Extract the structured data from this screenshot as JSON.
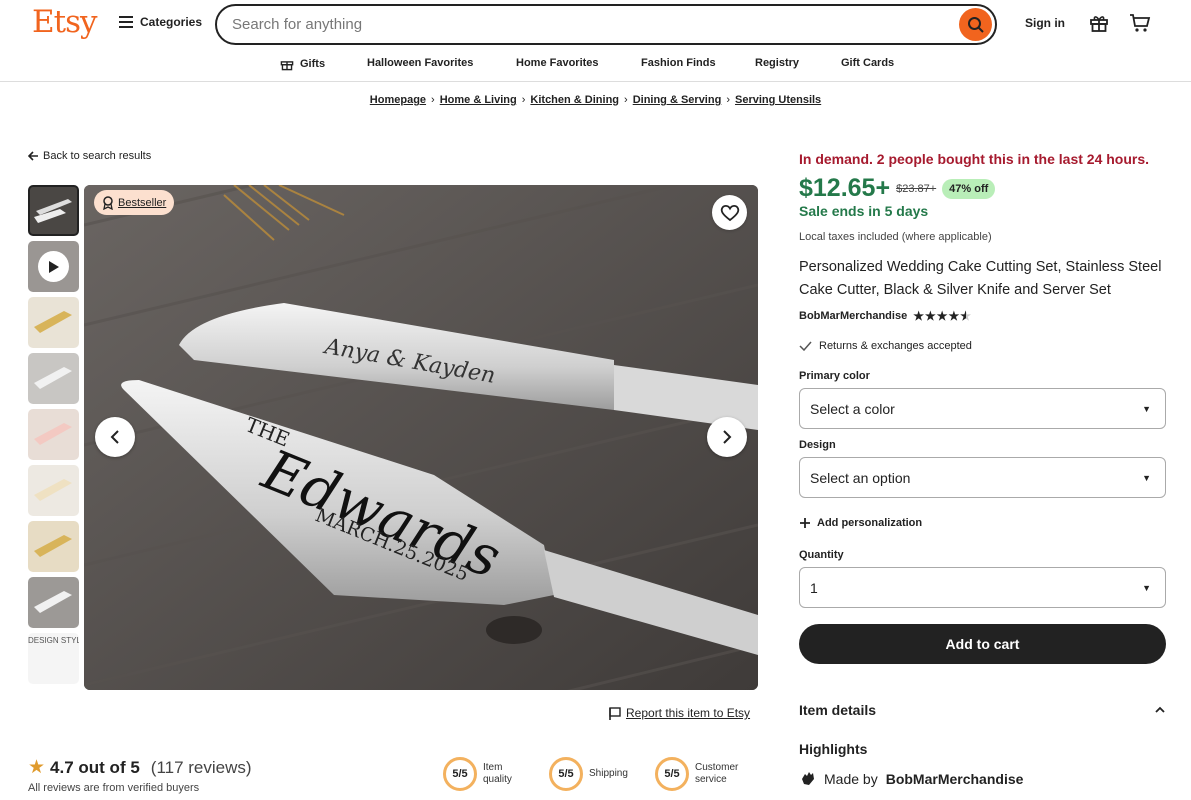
{
  "header": {
    "logo": "Etsy",
    "categories_label": "Categories",
    "search_placeholder": "Search for anything",
    "signin_label": "Sign in"
  },
  "nav": {
    "items": [
      "Gifts",
      "Halloween Favorites",
      "Home Favorites",
      "Fashion Finds",
      "Registry",
      "Gift Cards"
    ]
  },
  "breadcrumb": [
    "Homepage",
    "Home & Living",
    "Kitchen & Dining",
    "Dining & Serving",
    "Serving Utensils"
  ],
  "gallery": {
    "back_label": "Back to search results",
    "badge_label": "Bestseller",
    "report_label": "Report this item to Etsy",
    "engraving": {
      "knife_text": "Anya & Kayden",
      "server_the": "THE",
      "server_name": "Edwards",
      "server_date": "MARCH.25.2025"
    },
    "thumb_text": "DESIGN STYLE"
  },
  "reviews": {
    "rating": "4.7 out of 5",
    "count": "(117 reviews)",
    "verified": "All reviews are from verified buyers",
    "scores": [
      {
        "value": "5/5",
        "label_1": "Item",
        "label_2": "quality"
      },
      {
        "value": "5/5",
        "label_1": "Shipping",
        "label_2": ""
      },
      {
        "value": "5/5",
        "label_1": "Customer",
        "label_2": "service"
      }
    ]
  },
  "product": {
    "demand": "In demand. 2 people bought this in the last 24 hours.",
    "price": "$12.65+",
    "original_price": "$23.87+",
    "discount": "47% off",
    "sale_ends": "Sale ends in 5 days",
    "tax_note": "Local taxes included (where applicable)",
    "title": "Personalized Wedding Cake Cutting Set, Stainless Steel Cake Cutter, Black & Silver Knife and Server Set",
    "shop": "BobMarMerchandise",
    "stars": 4.5,
    "returns": "Returns & exchanges accepted",
    "primary_color_label": "Primary color",
    "primary_color_value": "Select a color",
    "design_label": "Design",
    "design_value": "Select an option",
    "personalization_label": "Add personalization",
    "quantity_label": "Quantity",
    "quantity_value": "1",
    "add_to_cart": "Add to cart",
    "item_details": "Item details",
    "highlights": "Highlights",
    "made_by_prefix": "Made by",
    "made_by_shop": "BobMarMerchandise"
  },
  "colors": {
    "brand": "#F1641E",
    "sale_green": "#24794a",
    "demand_red": "#A61A2E",
    "discount_bg": "#b9eeb8",
    "score_ring": "#f3b15e"
  }
}
